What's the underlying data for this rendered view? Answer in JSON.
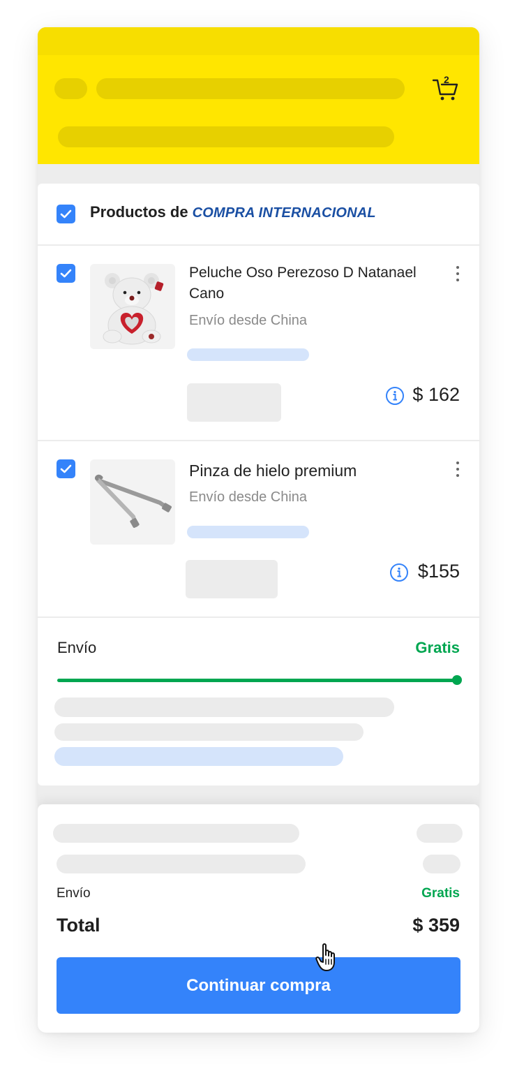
{
  "header": {
    "cart_count": "2",
    "cart_icon": "cart-icon",
    "bg_color": "#ffe600"
  },
  "section": {
    "title_prefix": "Productos de",
    "title_highlight": "COMPRA INTERNACIONAL",
    "checked": true
  },
  "products": [
    {
      "title": "Peluche Oso Perezoso D Natanael Cano",
      "shipping_origin": "Envío desde China",
      "price": "$ 162",
      "checked": true,
      "image": "teddy-bear-image"
    },
    {
      "title": "Pinza de hielo premium",
      "shipping_origin": "Envío desde China",
      "price": "$155",
      "checked": true,
      "image": "ice-tongs-image"
    }
  ],
  "shipping": {
    "label": "Envío",
    "value": "Gratis",
    "progress": 1.0
  },
  "summary": {
    "shipping_label": "Envío",
    "shipping_value": "Gratis",
    "total_label": "Total",
    "total_value": "$ 359",
    "cta_label": "Continuar compra"
  },
  "colors": {
    "accent_blue": "#3483fa",
    "success_green": "#00a650",
    "brand_yellow": "#ffe600",
    "international_blue": "#1a4fa3"
  }
}
